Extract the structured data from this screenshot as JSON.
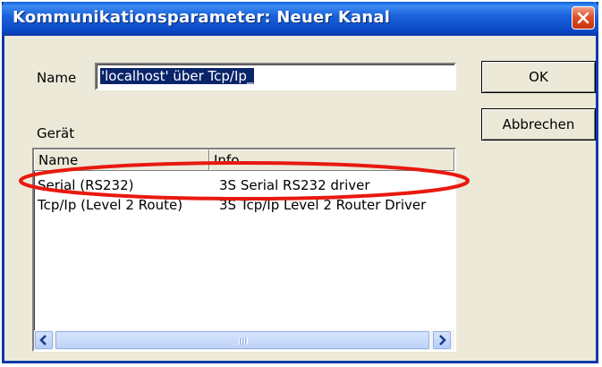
{
  "dialog": {
    "title": "Kommunikationsparameter: Neuer Kanal"
  },
  "form": {
    "name_label": "Name",
    "name_value": "'localhost' über Tcp/Ip_",
    "device_label": "Gerät"
  },
  "buttons": {
    "ok": "OK",
    "cancel": "Abbrechen"
  },
  "device_list": {
    "columns": [
      "Name",
      "Info"
    ],
    "rows": [
      {
        "name": "Serial (RS232)",
        "info": "3S Serial RS232 driver"
      },
      {
        "name": "Tcp/Ip (Level 2 Route)",
        "info": "3S Tcp/Ip Level 2 Router Driver"
      }
    ]
  },
  "colors": {
    "titlebar": "#0a48c6",
    "highlight_ellipse": "#e8190f",
    "selection": "#0a246a"
  },
  "icons": {
    "close": "close-icon",
    "scroll_left": "chevron-left-icon",
    "scroll_right": "chevron-right-icon"
  }
}
